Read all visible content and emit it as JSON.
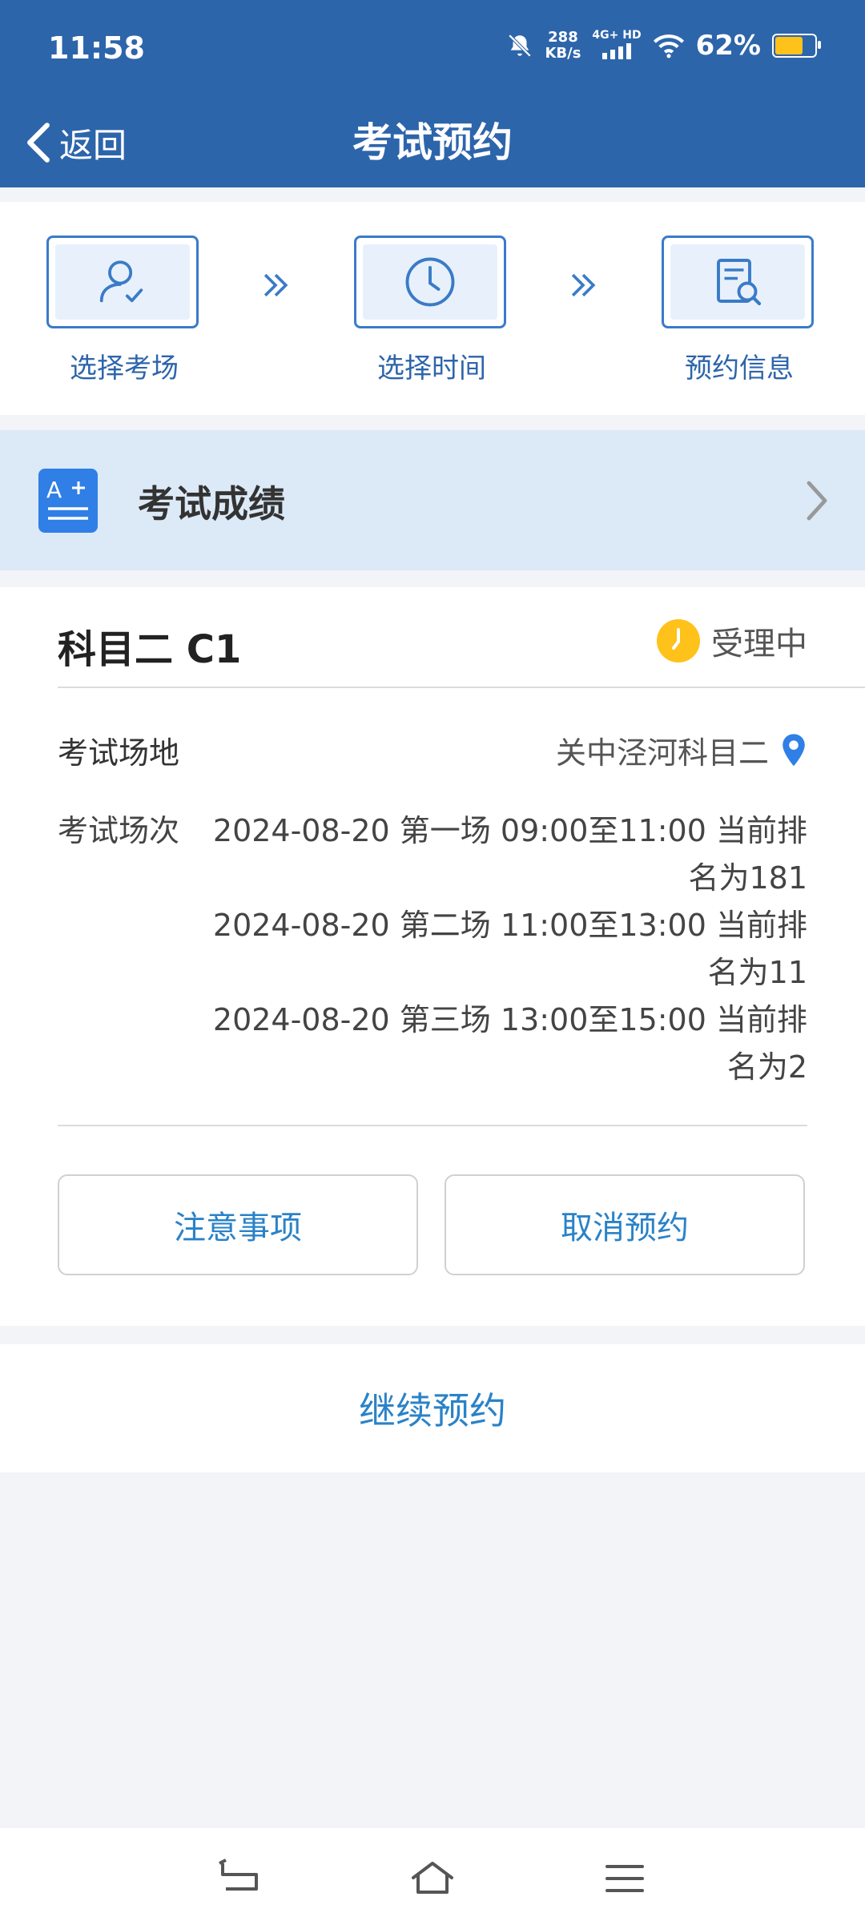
{
  "status_bar": {
    "time": "11:58",
    "net_speed_value": "288",
    "net_speed_unit": "KB/s",
    "network": "4G+ HD",
    "battery": "62%",
    "battery_level": 0.62,
    "icons": [
      "bell-muted-icon",
      "signal-icon",
      "wifi-icon",
      "battery-icon"
    ]
  },
  "nav": {
    "back_label": "返回",
    "title": "考试预约"
  },
  "steps": [
    {
      "label": "选择考场",
      "icon": "user-check-icon"
    },
    {
      "label": "选择时间",
      "icon": "clock-icon"
    },
    {
      "label": "预约信息",
      "icon": "document-search-icon"
    }
  ],
  "score_entry": {
    "label": "考试成绩",
    "icon": "grade-icon"
  },
  "booking": {
    "subject": "科目二 C1",
    "status": "受理中",
    "venue_label": "考试场地",
    "venue": "关中泾河科目二",
    "sessions_label": "考试场次",
    "sessions": [
      "2024-08-20 第一场 09:00至11:00 当前排名为181",
      "2024-08-20 第二场 11:00至13:00 当前排名为11",
      "2024-08-20 第三场 13:00至15:00 当前排名为2"
    ],
    "notice_button": "注意事项",
    "cancel_button": "取消预约"
  },
  "continue_button": "继续预约",
  "colors": {
    "primary": "#2d65ab",
    "accent": "#2a82c8",
    "pending": "#ffc21a"
  }
}
